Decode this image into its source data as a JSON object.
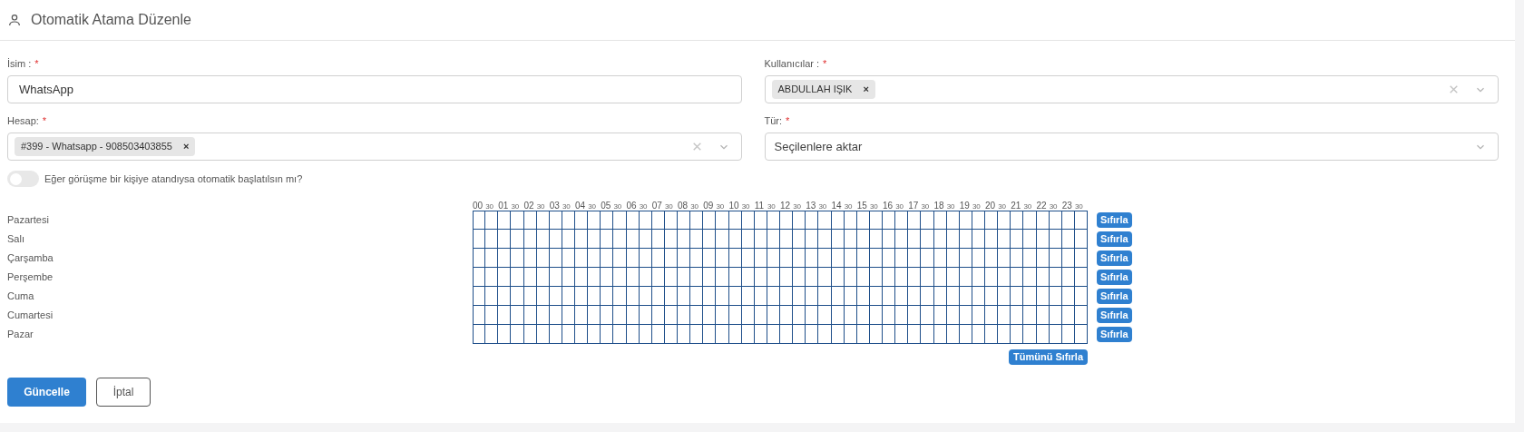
{
  "header": {
    "title": "Otomatik Atama Düzenle"
  },
  "fields": [
    {
      "label": "İsim :",
      "required": true,
      "kind": "text",
      "value": "WhatsApp"
    },
    {
      "label": "Kullanıcılar :",
      "required": true,
      "kind": "multiselect",
      "tags": [
        "ABDULLAH IŞIK"
      ]
    },
    {
      "label": "Hesap:",
      "required": true,
      "kind": "multiselect",
      "tags": [
        "#399 - Whatsapp - 908503403855"
      ]
    },
    {
      "label": "Tür:",
      "required": true,
      "kind": "select",
      "value": "Seçilenlere aktar"
    }
  ],
  "required_mark": "*",
  "tag_remove": "×",
  "toggle": {
    "label": "Eğer görüşme bir kişiye atandıysa otomatik başlatılsın mı?",
    "on": false
  },
  "schedule": {
    "time_labels": [
      "00",
      "30",
      "01",
      "30",
      "02",
      "30",
      "03",
      "30",
      "04",
      "30",
      "05",
      "30",
      "06",
      "30",
      "07",
      "30",
      "08",
      "30",
      "09",
      "30",
      "10",
      "30",
      "11",
      "30",
      "12",
      "30",
      "13",
      "30",
      "14",
      "30",
      "15",
      "30",
      "16",
      "30",
      "17",
      "30",
      "18",
      "30",
      "19",
      "30",
      "20",
      "30",
      "21",
      "30",
      "22",
      "30",
      "23",
      "30"
    ],
    "days": [
      {
        "name": "Pazartesi",
        "reset": "Sıfırla"
      },
      {
        "name": "Salı",
        "reset": "Sıfırla"
      },
      {
        "name": "Çarşamba",
        "reset": "Sıfırla"
      },
      {
        "name": "Perşembe",
        "reset": "Sıfırla"
      },
      {
        "name": "Cuma",
        "reset": "Sıfırla"
      },
      {
        "name": "Cumartesi",
        "reset": "Sıfırla"
      },
      {
        "name": "Pazar",
        "reset": "Sıfırla"
      }
    ],
    "reset_all": "Tümünü Sıfırla"
  },
  "buttons": [
    {
      "label": "Güncelle",
      "kind": "primary"
    },
    {
      "label": "İptal",
      "kind": "secondary"
    }
  ]
}
